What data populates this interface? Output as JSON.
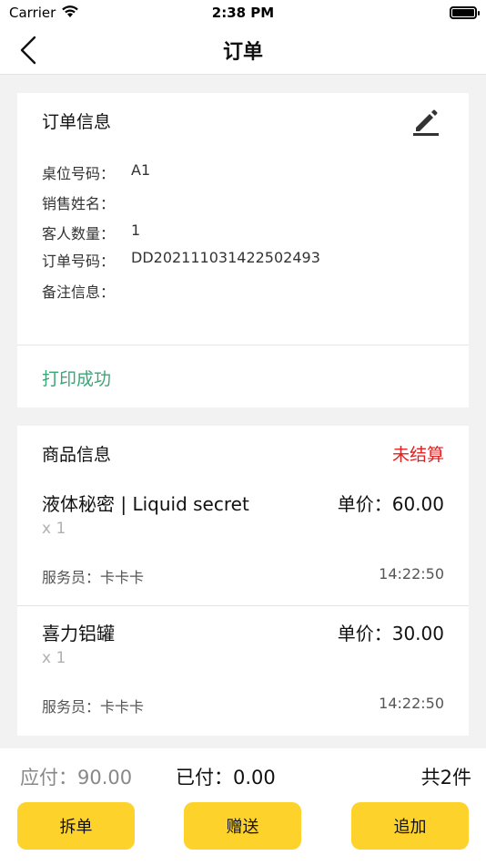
{
  "status_bar": {
    "carrier": "Carrier",
    "time": "2:38 PM",
    "icons": [
      "wifi-icon",
      "battery-icon"
    ]
  },
  "nav": {
    "title": "订单",
    "back_icon": "chevron-left-icon"
  },
  "order_info": {
    "title": "订单信息",
    "edit_icon": "pencil-icon",
    "rows": [
      {
        "label": "桌位号码：",
        "value": "A1"
      },
      {
        "label": "销售姓名：",
        "value": ""
      },
      {
        "label": "客人数量：",
        "value": "1"
      },
      {
        "label": "订单号码：",
        "value": "DD20211103142250249З"
      },
      {
        "label": "备注信息：",
        "value": ""
      }
    ]
  },
  "print_status": "打印成功",
  "goods": {
    "title": "商品信息",
    "status": "未结算",
    "status_color": "#e01f1f",
    "items": [
      {
        "name": "液体秘密 | Liquid secret",
        "price": "单价：60.00",
        "qty": "x 1",
        "waiter": "服务员：卡卡卡",
        "time": "14:22:50"
      },
      {
        "name": "喜力铝罐",
        "price": "单价：30.00",
        "qty": "x 1",
        "waiter": "服务员：卡卡卡",
        "time": "14:22:50"
      }
    ]
  },
  "footer": {
    "due": "应付：90.00",
    "paid": "已付：0.00",
    "count": "共2件",
    "buttons": {
      "split": "拆单",
      "gift": "赠送",
      "add": "追加"
    },
    "accent": "#fdd32b"
  }
}
